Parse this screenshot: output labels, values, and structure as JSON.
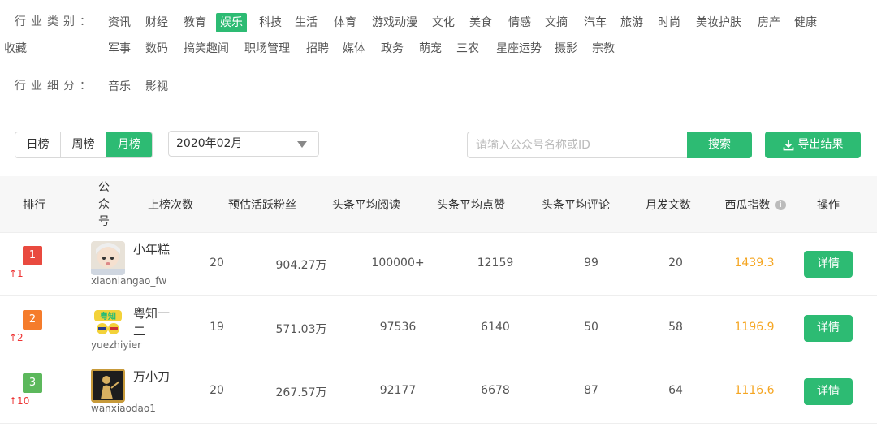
{
  "filters": {
    "industry_label": "行业类别：",
    "industry_tags": [
      "资讯",
      "财经",
      "教育",
      "娱乐",
      "科技",
      "生活",
      "体育",
      "游戏动漫",
      "文化",
      "美食",
      "情感",
      "文摘",
      "汽车",
      "旅游",
      "时尚",
      "美妆护肤",
      "房产",
      "健康",
      "军事",
      "数码",
      "搞笑趣闻",
      "职场管理",
      "招聘",
      "媒体",
      "政务",
      "萌宠",
      "三农",
      "星座运势",
      "摄影",
      "宗教",
      "收藏"
    ],
    "industry_active": "娱乐",
    "sub_label": "行业细分：",
    "sub_tags": [
      "音乐",
      "影视"
    ]
  },
  "controls": {
    "periods": [
      "日榜",
      "周榜",
      "月榜"
    ],
    "period_active": "月榜",
    "month": "2020年02月",
    "search_placeholder": "请输入公众号名称或ID",
    "search_label": "搜索",
    "export_label": "导出结果"
  },
  "table": {
    "headers": {
      "rank": "排行",
      "account": [
        "公",
        "众",
        "号"
      ],
      "times": "上榜次数",
      "fans": "预估活跃粉丝",
      "reads": "头条平均阅读",
      "likes": "头条平均点赞",
      "comments": "头条平均评论",
      "posts": "月发文数",
      "index": "西瓜指数",
      "action": "操作"
    },
    "rows": [
      {
        "rank": "1",
        "rank_color": "#e94a3f",
        "change": "↑1",
        "name": "小年糕",
        "id": "xiaoniangao_fw",
        "times": "20",
        "fans": "904.27万",
        "reads": "100000+",
        "likes": "12159",
        "comments": "99",
        "posts": "20",
        "index": "1439.3",
        "action": "详情"
      },
      {
        "rank": "2",
        "rank_color": "#f57c2b",
        "change": "↑2",
        "name": "粤知一二",
        "id": "yuezhiyier",
        "times": "19",
        "fans": "571.03万",
        "reads": "97536",
        "likes": "6140",
        "comments": "50",
        "posts": "58",
        "index": "1196.9",
        "action": "详情"
      },
      {
        "rank": "3",
        "rank_color": "#5cb85c",
        "change": "↑10",
        "name": "万小刀",
        "id": "wanxiaodao1",
        "times": "20",
        "fans": "267.57万",
        "reads": "92177",
        "likes": "6678",
        "comments": "87",
        "posts": "64",
        "index": "1116.6",
        "action": "详情"
      }
    ]
  },
  "colors": {
    "accent": "#2dbb73",
    "index_orange": "#f5a623",
    "rank_up": "#e33"
  }
}
